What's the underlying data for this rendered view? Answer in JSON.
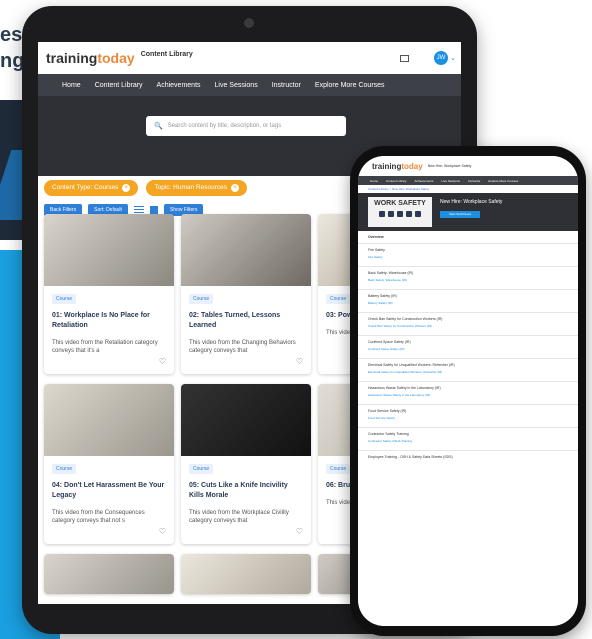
{
  "background": {
    "text_lines": [
      "es",
      "ng"
    ]
  },
  "tablet": {
    "brand_primary": "training",
    "brand_accent": "today",
    "brand_colors": {
      "primary": "#333333",
      "accent": "#e8893c"
    },
    "section_label": "Content Library",
    "avatar_initials": "JW",
    "nav": [
      "Home",
      "Content Library",
      "Achievements",
      "Live Sessions",
      "Instructor",
      "Explore More Courses"
    ],
    "search_placeholder": "Search content by title, description, or tags",
    "filters": [
      {
        "label": "Content Type: Courses"
      },
      {
        "label": "Topic: Human Resources"
      }
    ],
    "tools": [
      "Back Filters",
      "Sort: Default",
      "Show Filters"
    ],
    "cards": [
      {
        "badge": "Course",
        "title": "01: Workplace Is No Place for Retaliation",
        "desc": "This video from the Retaliation category conveys that it's a"
      },
      {
        "badge": "Course",
        "title": "02: Tables Turned, Lessons Learned",
        "desc": "This video from the Changing Behaviors category conveys that"
      },
      {
        "badge": "Course",
        "title": "03: Pow",
        "desc": "This video category c"
      },
      {
        "badge": "Course",
        "title": "04: Don't Let Harassment Be Your Legacy",
        "desc": "This video from the Consequences category conveys that not s"
      },
      {
        "badge": "Course",
        "title": "05: Cuts Like a Knife Incivility Kills Morale",
        "desc": "This video from the Workplace Civility category conveys that"
      },
      {
        "badge": "Course",
        "title": "06: Brush \"Taking a",
        "desc": "This video Interventio"
      }
    ]
  },
  "phone": {
    "brand_primary": "training",
    "brand_accent": "today",
    "page_title": "New Hire: Workplace Safety",
    "nav": [
      "Home",
      "Content Library",
      "Achievements",
      "Live Sessions",
      "Instructor",
      "Explore More Courses"
    ],
    "breadcrumb": "Content Library  >  New Hire: Workplace Safety",
    "hero_image_text": "WORK SAFETY",
    "hero_title": "New Hire: Workplace Safety",
    "start_button": "Start Self-Paced",
    "overview_label": "Overview",
    "rows": [
      {
        "title": "Fire Safety",
        "sub": "Fire Safety"
      },
      {
        "title": "Back Safety: Warehouse (IR)",
        "sub": "Back Safety: Warehouse (IR)"
      },
      {
        "title": "Battery Safety (IR)",
        "sub": "Battery Safety (IR)"
      },
      {
        "title": "Check Ban Safety for Construction Workers (IR)",
        "sub": "Check Ban Safety for Construction Workers (IR)"
      },
      {
        "title": "Confined Space Safety (IR)",
        "sub": "Confined Space Safety (IR)"
      },
      {
        "title": "Electrical Safety for Unqualified Workers: Refresher (IR)",
        "sub": "Electrical Safety for Unqualified Workers: Refresher (IR)"
      },
      {
        "title": "Hazardous Waste Safety in the Laboratory (IR)",
        "sub": "Hazardous Waste Safety in the Laboratory (IR)"
      },
      {
        "title": "Food Service Safety (IR)",
        "sub": "Food Service Safety"
      },
      {
        "title": "Contractor Safety Training",
        "sub": "Contractor Safety OSHA Training"
      },
      {
        "title": "Employee Training - OSH & Safety Data Sheets (SDS)",
        "sub": ""
      }
    ]
  }
}
